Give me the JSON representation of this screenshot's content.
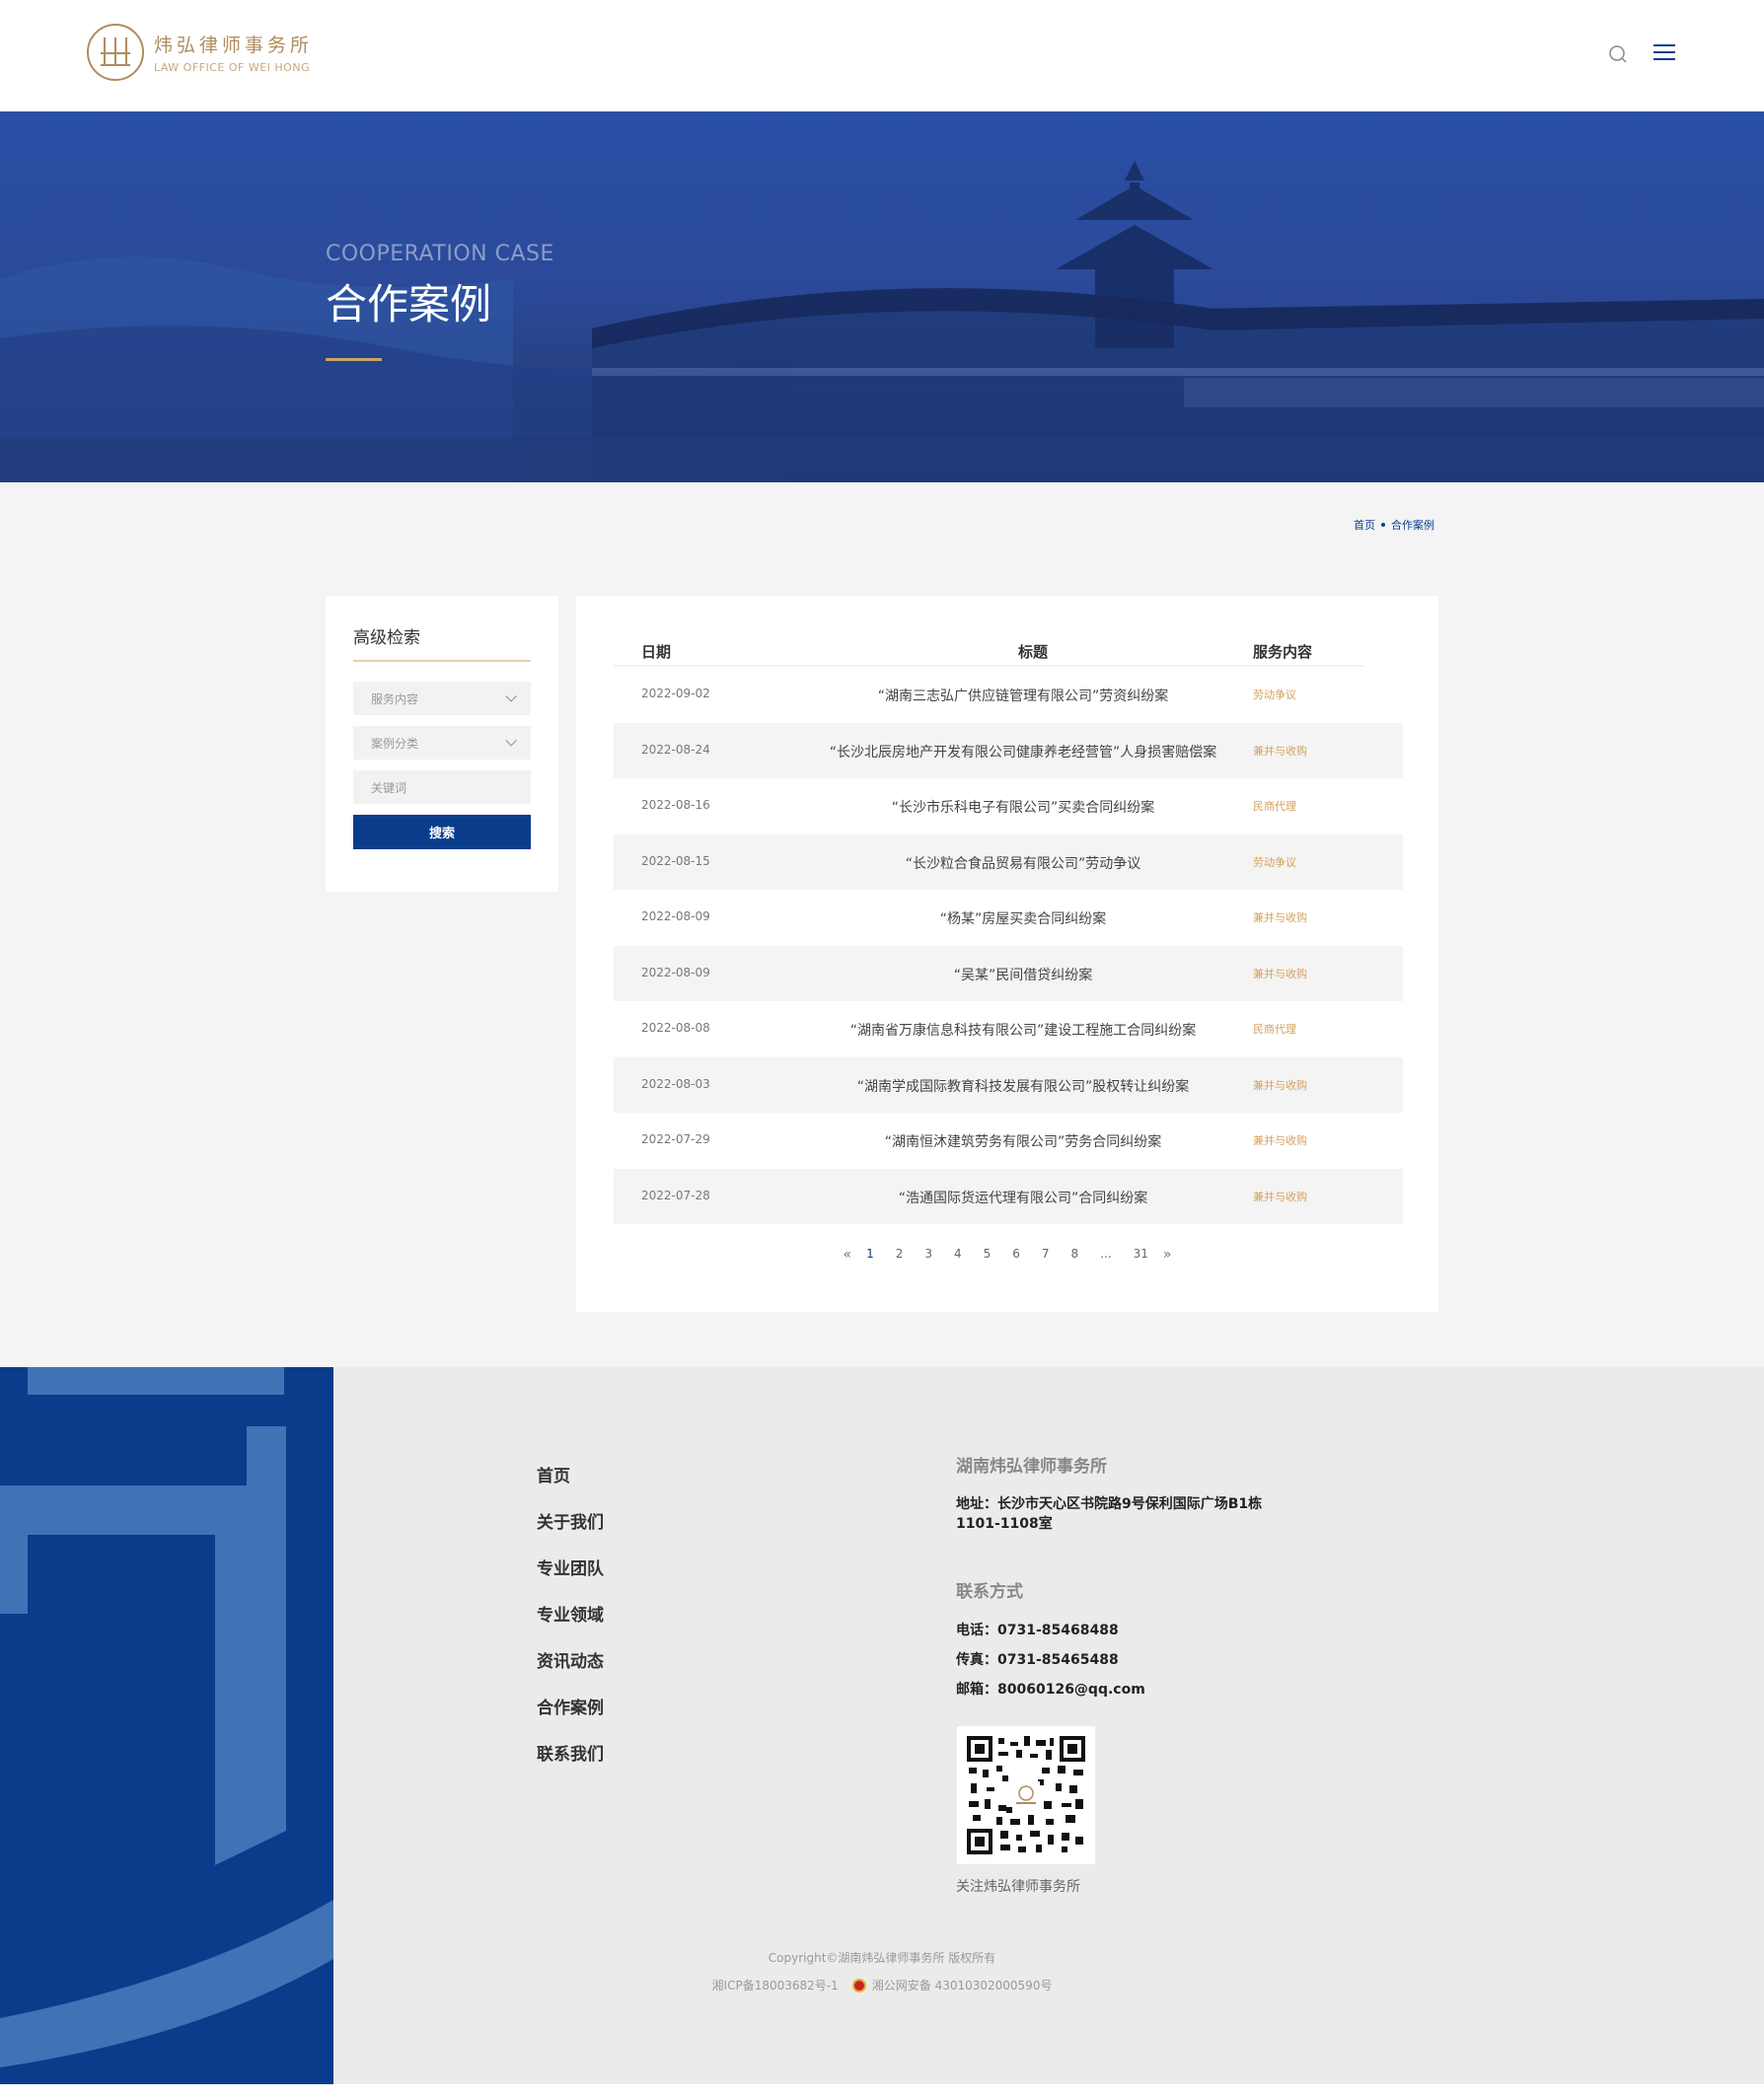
{
  "header": {
    "logo_cn": "炜弘律师事务所",
    "logo_en": "LAW OFFICE OF WEI HONG"
  },
  "banner": {
    "en": "COOPERATION CASE",
    "cn": "合作案例"
  },
  "breadcrumb": {
    "home": "首页",
    "current": "合作案例"
  },
  "sidebar": {
    "title": "高级检索",
    "service_select": "服务内容",
    "category_select": "案例分类",
    "keyword_placeholder": "关键词",
    "search_button": "搜索"
  },
  "table": {
    "headers": {
      "date": "日期",
      "title": "标题",
      "service": "服务内容"
    },
    "rows": [
      {
        "date": "2022-09-02",
        "title": "“湖南三志弘广供应链管理有限公司”劳资纠纷案",
        "tag": "劳动争议"
      },
      {
        "date": "2022-08-24",
        "title": "“长沙北辰房地产开发有限公司健康养老经营管”人身损害赔偿案",
        "tag": "兼并与收购"
      },
      {
        "date": "2022-08-16",
        "title": "“长沙市乐科电子有限公司”买卖合同纠纷案",
        "tag": "民商代理"
      },
      {
        "date": "2022-08-15",
        "title": "“长沙粒合食品贸易有限公司”劳动争议",
        "tag": "劳动争议"
      },
      {
        "date": "2022-08-09",
        "title": "“杨某”房屋买卖合同纠纷案",
        "tag": "兼并与收购"
      },
      {
        "date": "2022-08-09",
        "title": "“吴某”民间借贷纠纷案",
        "tag": "兼并与收购"
      },
      {
        "date": "2022-08-08",
        "title": "“湖南省万康信息科技有限公司”建设工程施工合同纠纷案",
        "tag": "民商代理"
      },
      {
        "date": "2022-08-03",
        "title": "“湖南学成国际教育科技发展有限公司”股权转让纠纷案",
        "tag": "兼并与收购"
      },
      {
        "date": "2022-07-29",
        "title": "“湖南恒沐建筑劳务有限公司”劳务合同纠纷案",
        "tag": "兼并与收购"
      },
      {
        "date": "2022-07-28",
        "title": "“浩通国际货运代理有限公司”合同纠纷案",
        "tag": "兼并与收购"
      }
    ]
  },
  "pagination": {
    "prev": "«",
    "pages": [
      "1",
      "2",
      "3",
      "4",
      "5",
      "6",
      "7",
      "8",
      "...",
      "31"
    ],
    "next": "»",
    "current": "1"
  },
  "footer": {
    "nav": [
      "首页",
      "关于我们",
      "专业团队",
      "专业领域",
      "资讯动态",
      "合作案例",
      "联系我们"
    ],
    "company": "湖南炜弘律师事务所",
    "address": "地址：长沙市天心区书院路9号保利国际广场B1栋1101-1108室",
    "contact_title": "联系方式",
    "phone": "电话：0731-85468488",
    "fax": "传真：0731-85465488",
    "email": "邮箱：80060126@qq.com",
    "qr_caption": "关注炜弘律师事务所",
    "copyright": "Copyright©湖南炜弘律师事务所 版权所有",
    "icp": "湘ICP备18003682号-1",
    "police": "湘公网安备 43010302000590号"
  },
  "colors": {
    "primary": "#0a3c8c",
    "gold": "#c9a46b",
    "tag": "#d4a15e"
  }
}
